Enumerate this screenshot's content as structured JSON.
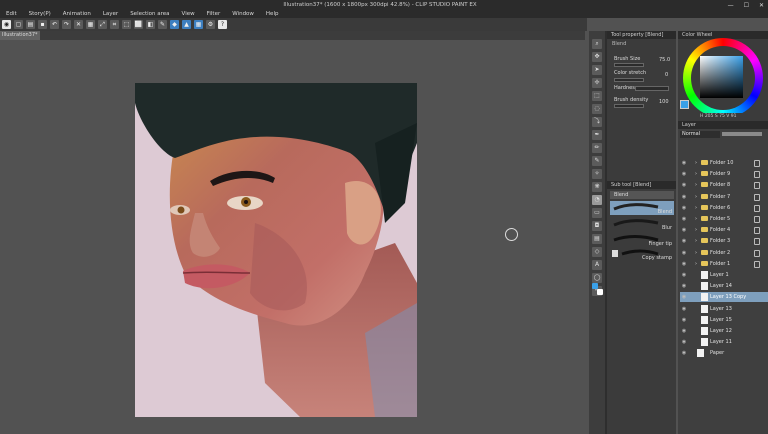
{
  "window": {
    "title": "Illustration37* (1600 x 1800px 300dpi 42.8%)  - CLIP STUDIO PAINT EX",
    "controls": [
      "—",
      "☐",
      "✕"
    ]
  },
  "menu": [
    "Edit",
    "Story(P)",
    "Animation",
    "Layer",
    "Selection area",
    "View",
    "Filter",
    "Window",
    "Help"
  ],
  "document_tab": "Illustration37*",
  "tool_property": {
    "header": "Tool property [Blend]",
    "sub_label": "Blend",
    "brush_size_label": "Brush Size",
    "brush_size_value": "75.0",
    "color_stretch_label": "Color stretch",
    "color_stretch_value": "0",
    "hardness_label": "Hardness",
    "brush_density_label": "Brush density",
    "brush_density_value": "100"
  },
  "sub_tool": {
    "header": "Sub tool [Blend]",
    "group_label": "Blend",
    "brushes": [
      {
        "label": "Blend"
      },
      {
        "label": "Blur"
      },
      {
        "label": "Finger tip"
      },
      {
        "label": "Copy stamp"
      }
    ]
  },
  "color_wheel": {
    "header": "Color Wheel",
    "main_color": "#3aa0e8",
    "readout": "H 205  S 75  V 91"
  },
  "layer_panel": {
    "header": "Layer",
    "blend_mode": "Normal",
    "layers": [
      {
        "name": "Folder 10",
        "type": "folder"
      },
      {
        "name": "Folder 9",
        "type": "folder"
      },
      {
        "name": "Folder 8",
        "type": "folder"
      },
      {
        "name": "Folder 7",
        "type": "folder"
      },
      {
        "name": "Folder 6",
        "type": "folder"
      },
      {
        "name": "Folder 5",
        "type": "folder"
      },
      {
        "name": "Folder 4",
        "type": "folder"
      },
      {
        "name": "Folder 3",
        "type": "folder"
      },
      {
        "name": "Folder 2",
        "type": "folder"
      },
      {
        "name": "Folder 1",
        "type": "folder"
      },
      {
        "name": "Layer 1",
        "type": "layer"
      },
      {
        "name": "Layer 14",
        "type": "layer"
      },
      {
        "name": "Layer 13 Copy",
        "type": "layer",
        "selected": true
      },
      {
        "name": "Layer 13",
        "type": "layer"
      },
      {
        "name": "Layer 15",
        "type": "layer"
      },
      {
        "name": "Layer 12",
        "type": "layer"
      },
      {
        "name": "Layer 11",
        "type": "layer"
      },
      {
        "name": "Paper",
        "type": "paper"
      }
    ]
  },
  "icons": {
    "eye": "eye-icon",
    "lock": "lock-icon",
    "folder": "folder-icon",
    "help": "help-icon"
  },
  "colors": {
    "selection": "#7e9fbd",
    "accent": "#3aa0e8",
    "folder": "#e5c55a"
  }
}
